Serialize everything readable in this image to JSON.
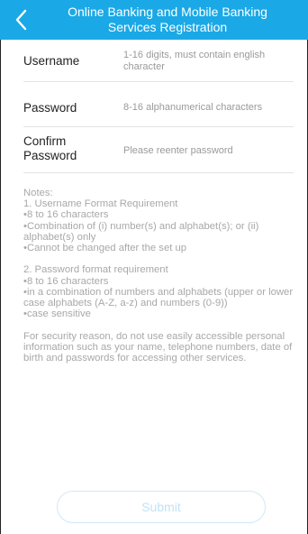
{
  "header": {
    "title": "Online Banking and Mobile Banking\nServices Registration",
    "back_icon": "chevron-left-icon",
    "background": "#1aa9e6"
  },
  "form": {
    "username": {
      "label": "Username",
      "placeholder": "1-16 digits, must contain english character"
    },
    "password": {
      "label": "Password",
      "placeholder": "8-16 alphanumerical characters"
    },
    "confirm_password": {
      "label": "Confirm\nPassword",
      "placeholder": "Please reenter password"
    }
  },
  "notes": "Notes:\n1. Username Format Requirement\n      •8 to 16 characters\n      •Combination of (i) number(s) and alphabet(s); or (ii) alphabet(s) only\n      •Cannot be changed after the set up\n\n2. Password format requirement\n      •8 to 16 characters\n      •in a combination of numbers and alphabets (upper or lower case alphabets (A-Z, a-z) and numbers (0-9))\n      •case sensitive\n\nFor security reason, do not use easily accessible personal information such as your name, telephone numbers, date of birth and passwords for accessing other services.",
  "submit": {
    "label": "Submit"
  }
}
